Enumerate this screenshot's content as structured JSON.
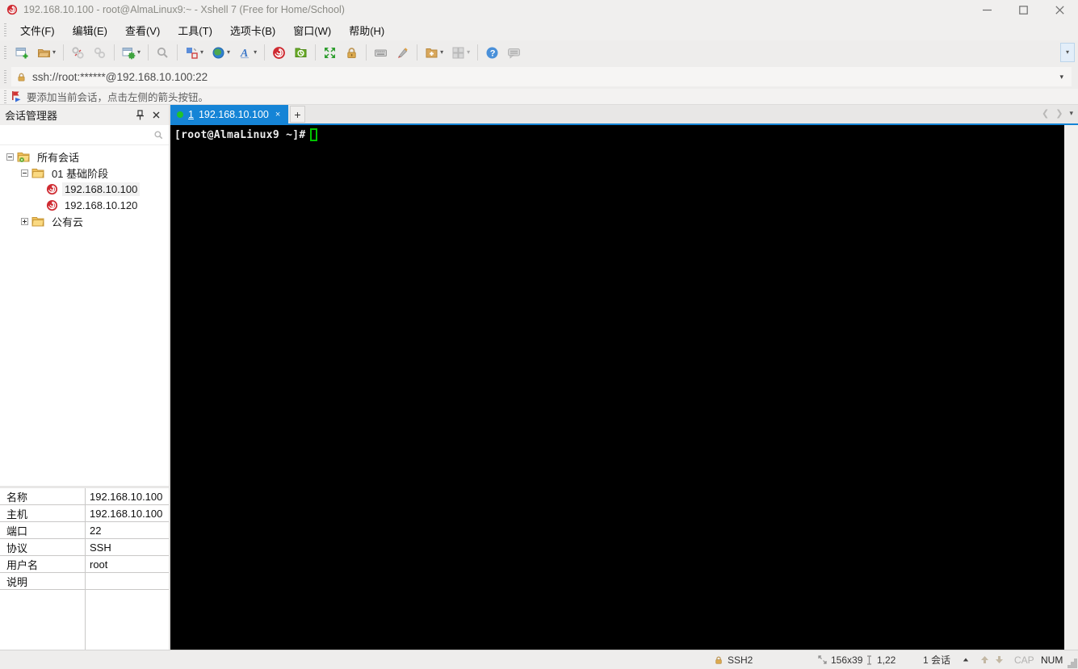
{
  "window": {
    "title": "192.168.10.100 - root@AlmaLinux9:~ - Xshell 7 (Free for Home/School)"
  },
  "menu": {
    "items": [
      "文件(F)",
      "编辑(E)",
      "查看(V)",
      "工具(T)",
      "选项卡(B)",
      "窗口(W)",
      "帮助(H)"
    ]
  },
  "toolbar": {
    "icons": [
      "new-session",
      "open-folder",
      "disconnect",
      "reconnect",
      "session-properties",
      "find",
      "tile-layout",
      "web-globe",
      "font",
      "xshell",
      "xftp",
      "fullscreen",
      "lock",
      "virtual-keyboard",
      "highlighter",
      "new-terminal",
      "grid-layout",
      "help",
      "feedback",
      "toolbar-overflow"
    ]
  },
  "addressbar": {
    "value": "ssh://root:******@192.168.10.100:22"
  },
  "infobar": {
    "message": "要添加当前会话，点击左侧的箭头按钮。"
  },
  "sidebar": {
    "title": "会话管理器",
    "tree": [
      {
        "label": "所有会话"
      },
      {
        "label": "01 基础阶段"
      },
      {
        "label": "192.168.10.100"
      },
      {
        "label": "192.168.10.120"
      },
      {
        "label": "公有云"
      }
    ],
    "properties": {
      "rows": [
        {
          "label": "名称",
          "value": "192.168.10.100"
        },
        {
          "label": "主机",
          "value": "192.168.10.100"
        },
        {
          "label": "端口",
          "value": "22"
        },
        {
          "label": "协议",
          "value": "SSH"
        },
        {
          "label": "用户名",
          "value": "root"
        },
        {
          "label": "说明",
          "value": ""
        }
      ]
    }
  },
  "tabs": {
    "active": {
      "index": "1",
      "label": "192.168.10.100",
      "close": "×"
    },
    "new_tab": "+"
  },
  "terminal": {
    "prompt": "[root@AlmaLinux9 ~]#"
  },
  "statusbar": {
    "protocol": "SSH2",
    "size": "156x39",
    "cursor_pos": "1,22",
    "session_count": "1 会话",
    "cap": "CAP",
    "num": "NUM"
  },
  "colors": {
    "accent_blue": "#1584d6",
    "tab_green_dot": "#21c32b",
    "terminal_bg": "#000000",
    "terminal_text": "#ececec",
    "cursor_green": "#00c300",
    "xshell_red": "#cf2b32"
  }
}
